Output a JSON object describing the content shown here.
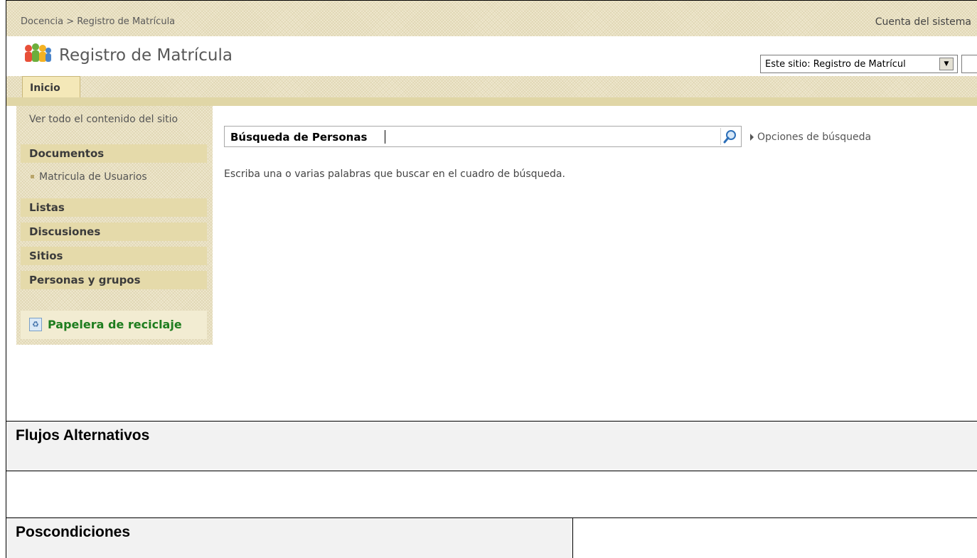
{
  "breadcrumb": "Docencia > Registro de Matrícula",
  "account": "Cuenta del sistema",
  "site_title": "Registro de Matrícula",
  "search_scope": "Este sitio: Registro de Matrícul",
  "tab_inicio": "Inicio",
  "nav": {
    "view_all": "Ver todo el contenido del sitio",
    "documents": "Documentos",
    "doc_item": "Matricula de Usuarios",
    "lists": "Listas",
    "discussions": "Discusiones",
    "sites": "Sitios",
    "people": "Personas y grupos",
    "recycle": "Papelera de reciclaje"
  },
  "search": {
    "value": "Búsqueda de Personas",
    "options": "Opciones de búsqueda",
    "hint": "Escriba una o varias palabras que buscar en el cuadro de búsqueda."
  },
  "document": {
    "alt_flows": "Flujos Alternativos",
    "postconditions": "Poscondiciones"
  }
}
